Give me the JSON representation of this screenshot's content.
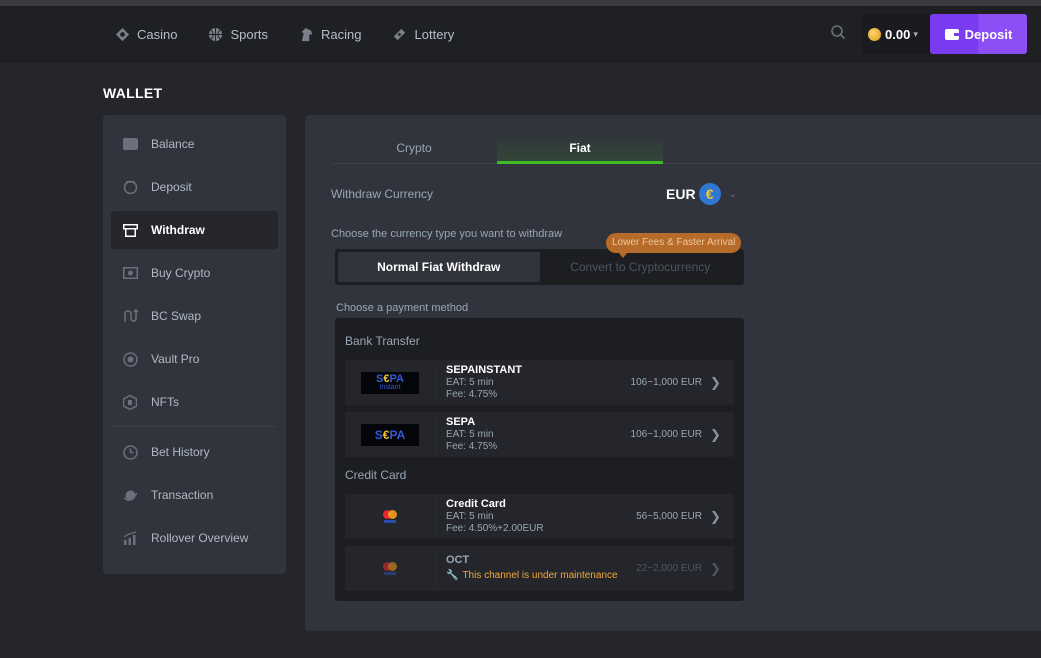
{
  "header": {
    "nav": [
      {
        "label": "Casino",
        "icon": "casino-icon"
      },
      {
        "label": "Sports",
        "icon": "sports-icon"
      },
      {
        "label": "Racing",
        "icon": "racing-icon"
      },
      {
        "label": "Lottery",
        "icon": "lottery-icon"
      }
    ],
    "balance": "0.00",
    "deposit_label": "Deposit"
  },
  "page": {
    "title": "WALLET"
  },
  "sidebar": {
    "items": [
      {
        "label": "Balance",
        "icon": "wallet-icon"
      },
      {
        "label": "Deposit",
        "icon": "deposit-icon"
      },
      {
        "label": "Withdraw",
        "icon": "withdraw-icon",
        "active": true
      },
      {
        "label": "Buy Crypto",
        "icon": "buy-crypto-icon"
      },
      {
        "label": "BC Swap",
        "icon": "swap-icon"
      },
      {
        "label": "Vault Pro",
        "icon": "vault-icon"
      },
      {
        "label": "NFTs",
        "icon": "nft-icon"
      },
      {
        "label": "Bet History",
        "icon": "clock-icon"
      },
      {
        "label": "Transaction",
        "icon": "transaction-icon"
      },
      {
        "label": "Rollover Overview",
        "icon": "chart-icon"
      }
    ]
  },
  "main": {
    "tabs": [
      {
        "label": "Crypto",
        "active": false
      },
      {
        "label": "Fiat",
        "active": true
      }
    ],
    "currency_label": "Withdraw Currency",
    "currency_code": "EUR",
    "currency_symbol": "€",
    "type_label": "Choose the currency type you want to withdraw",
    "type_options": [
      {
        "label": "Normal Fiat Withdraw",
        "active": true
      },
      {
        "label": "Convert to Cryptocurrency",
        "active": false
      }
    ],
    "badge": "Lower Fees & Faster Arrival",
    "method_label": "Choose a payment method",
    "groups": [
      {
        "label": "Bank Transfer",
        "methods": [
          {
            "name": "SEPAINSTANT",
            "eat": "EAT: 5 min",
            "fee": "Fee: 4.75%",
            "range": "106~1,000 EUR"
          },
          {
            "name": "SEPA",
            "eat": "EAT: 5 min",
            "fee": "Fee: 4.75%",
            "range": "106~1,000 EUR"
          }
        ]
      },
      {
        "label": "Credit Card",
        "methods": [
          {
            "name": "Credit Card",
            "eat": "EAT: 5 min",
            "fee": "Fee: 4.50%+2.00EUR",
            "range": "56~5,000 EUR"
          },
          {
            "name": "OCT",
            "maintenance": "This channel is under maintenance",
            "range": "22~2,000 EUR"
          }
        ]
      }
    ],
    "sepa_logo": {
      "prefix": "S",
      "euro": "€",
      "suffix": "PA",
      "sub": "Instant"
    }
  },
  "colors": {
    "accent_purple": "#7a3cf0",
    "tab_green": "#3dbc25",
    "badge_orange": "#b66b2a",
    "maintenance_orange": "#f2a93b"
  }
}
